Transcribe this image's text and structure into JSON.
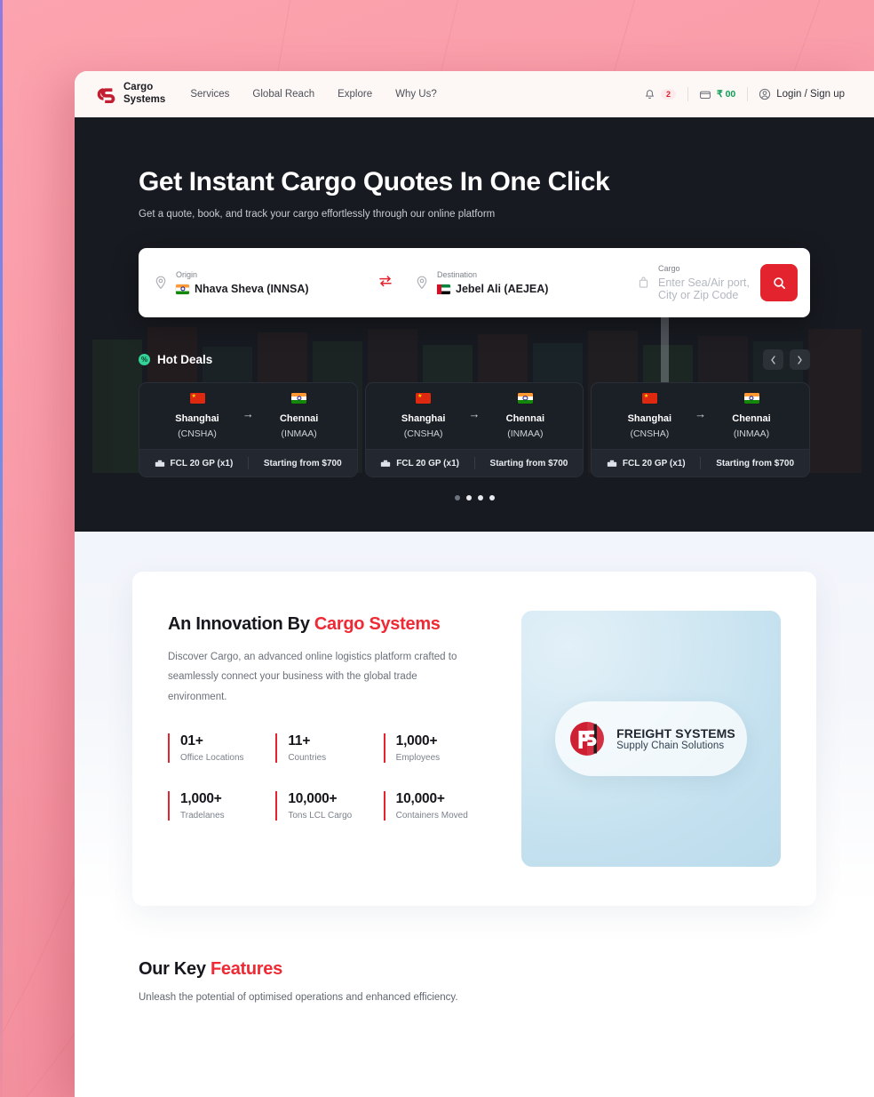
{
  "nav": {
    "brand_line1": "Cargo",
    "brand_line2": "Systems",
    "links": [
      {
        "label": "Services"
      },
      {
        "label": "Global Reach"
      },
      {
        "label": "Explore"
      },
      {
        "label": "Why Us?"
      }
    ],
    "notifications_count": "2",
    "wallet_amount": "₹ 00",
    "login_label": "Login / Sign up"
  },
  "hero": {
    "title": "Get Instant Cargo Quotes In One Click",
    "subtitle": "Get a quote, book, and track your cargo effortlessly through our online platform",
    "search": {
      "origin_label": "Origin",
      "origin_value": "Nhava Sheva (INNSA)",
      "destination_label": "Destination",
      "destination_value": "Jebel Ali (AEJEA)",
      "cargo_label": "Cargo",
      "cargo_placeholder": "Enter Sea/Air port, City or Zip Code"
    }
  },
  "hot_deals": {
    "title": "Hot Deals",
    "badge_glyph": "%",
    "prev_label": "‹",
    "next_label": "›",
    "cards": [
      {
        "origin_city": "Shanghai",
        "origin_code": "(CNSHA)",
        "dest_city": "Chennai",
        "dest_code": "(INMAA)",
        "container": "FCL 20 GP (x1)",
        "price": "Starting from $700"
      },
      {
        "origin_city": "Shanghai",
        "origin_code": "(CNSHA)",
        "dest_city": "Chennai",
        "dest_code": "(INMAA)",
        "container": "FCL 20 GP (x1)",
        "price": "Starting from $700"
      },
      {
        "origin_city": "Shanghai",
        "origin_code": "(CNSHA)",
        "dest_city": "Chennai",
        "dest_code": "(INMAA)",
        "container": "FCL 20 GP (x1)",
        "price": "Starting from $700"
      }
    ],
    "dots": [
      {
        "active": false
      },
      {
        "active": true
      },
      {
        "active": true
      },
      {
        "active": true
      }
    ]
  },
  "innovation": {
    "title_plain": "An Innovation By ",
    "title_accent": "Cargo Systems",
    "description": "Discover Cargo, an advanced online logistics platform crafted to seamlessly connect your business with the global trade environment.",
    "stats": [
      {
        "number": "01+",
        "label": "Office Locations"
      },
      {
        "number": "11+",
        "label": "Countries"
      },
      {
        "number": "1,000+",
        "label": "Employees"
      },
      {
        "number": "1,000+",
        "label": "Tradelanes"
      },
      {
        "number": "10,000+",
        "label": "Tons LCL Cargo"
      },
      {
        "number": "10,000+",
        "label": "Containers Moved"
      }
    ],
    "logo_line1": "FREIGHT SYSTEMS",
    "logo_line2": "Supply Chain Solutions"
  },
  "features": {
    "title_plain": "Our Key ",
    "title_accent": "Features",
    "subtitle": "Unleash the potential of optimised operations and enhanced efficiency."
  },
  "colors": {
    "accent_red": "#ef2a35",
    "brand_red": "#e3242f",
    "hero_dark": "#15181d",
    "success_green": "#0f9d58",
    "hot_badge": "#34d399",
    "page_pink": "#f99ba8"
  }
}
